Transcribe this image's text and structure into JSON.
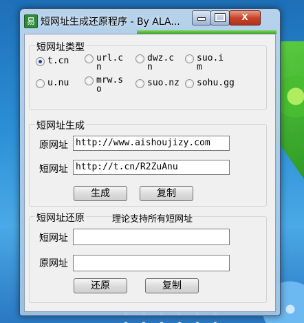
{
  "window": {
    "title": "短网址生成还原程序 - By ALA...",
    "app_icon_glyph": "易",
    "close_glyph": "X"
  },
  "types": {
    "title": "短网址类型",
    "options": [
      {
        "label": "t.cn",
        "selected": true
      },
      {
        "label": "url.cn",
        "selected": false
      },
      {
        "label": "dwz.cn",
        "selected": false
      },
      {
        "label": "suo.im",
        "selected": false
      },
      {
        "label": "u.nu",
        "selected": false
      },
      {
        "label": "mrw.so",
        "selected": false
      },
      {
        "label": "suo.nz",
        "selected": false
      },
      {
        "label": "sohu.gg",
        "selected": false
      }
    ]
  },
  "generate": {
    "title": "短网址生成",
    "original_label": "原网址",
    "original_value": "http://www.aishoujizy.com",
    "short_label": "短网址",
    "short_value": "http://t.cn/R2ZuAnu",
    "generate_button": "生成",
    "copy_button": "复制"
  },
  "restore": {
    "title": "短网址还原",
    "note": "理论支持所有短网址",
    "short_label": "短网址",
    "short_value": "",
    "original_label": "原网址",
    "original_value": "",
    "restore_button": "还原",
    "copy_button": "复制"
  },
  "colors": {
    "close_button": "#c7442a",
    "progress_strip": "#3aa526"
  }
}
